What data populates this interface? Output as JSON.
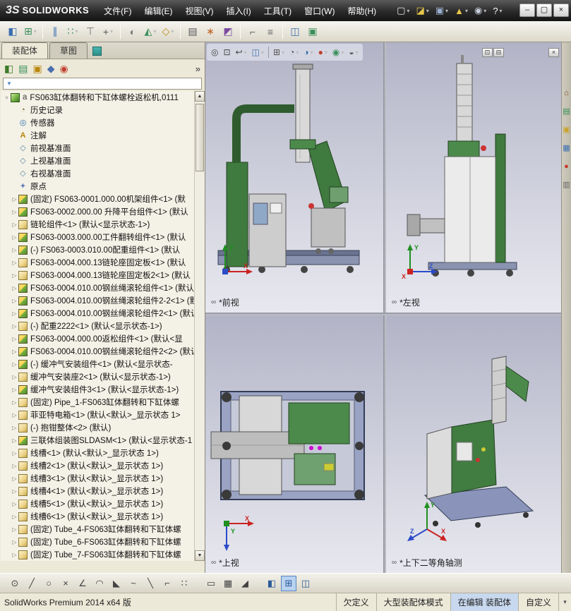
{
  "titlebar": {
    "logo_mark": "3S",
    "logo_text": "SOLIDWORKS",
    "menus": [
      {
        "key": "file",
        "label": "文件(F)"
      },
      {
        "key": "edit",
        "label": "编辑(E)"
      },
      {
        "key": "view",
        "label": "视图(V)"
      },
      {
        "key": "insert",
        "label": "插入(I)"
      },
      {
        "key": "tools",
        "label": "工具(T)"
      },
      {
        "key": "window",
        "label": "窗口(W)"
      },
      {
        "key": "help",
        "label": "帮助(H)"
      }
    ],
    "quick_icons": [
      {
        "name": "new-document-icon",
        "glyph": "▢",
        "color": "#e8e8e8",
        "dd": true
      },
      {
        "name": "open-document-icon",
        "glyph": "◪",
        "color": "#e8c84a",
        "dd": true
      },
      {
        "name": "save-icon",
        "glyph": "▣",
        "color": "#9ab0d0",
        "dd": true
      },
      {
        "name": "rebuild-alert-icon",
        "glyph": "▲",
        "color": "#e8c84a",
        "dd": true
      },
      {
        "name": "options-gear-icon",
        "glyph": "◉",
        "color": "#c8d0dc",
        "dd": true
      },
      {
        "name": "help-icon",
        "glyph": "?",
        "color": "#ffffff",
        "dd": true
      }
    ],
    "window_buttons": [
      {
        "name": "minimize-button",
        "glyph": "–"
      },
      {
        "name": "maximize-button",
        "glyph": "▢"
      },
      {
        "name": "close-button",
        "glyph": "×"
      }
    ]
  },
  "toolbar": {
    "items": [
      {
        "name": "edit-component-icon",
        "glyph": "◧",
        "color": "#3a6fb0"
      },
      {
        "name": "insert-component-icon",
        "glyph": "⊞",
        "color": "#3a8f5a",
        "dd": true
      },
      {
        "sep": true
      },
      {
        "name": "mate-icon",
        "glyph": "∥",
        "color": "#3a6fb0"
      },
      {
        "name": "component-pattern-icon",
        "glyph": "∷",
        "color": "#3a8f5a",
        "dd": true
      },
      {
        "name": "smart-fasteners-icon",
        "glyph": "⊤",
        "color": "#707070"
      },
      {
        "name": "move-component-icon",
        "glyph": "+",
        "color": "#555555",
        "dd": true
      },
      {
        "sep": true
      },
      {
        "name": "show-hidden-components-icon",
        "glyph": "◐",
        "color": "#777777"
      },
      {
        "name": "assembly-features-icon",
        "glyph": "◭",
        "color": "#3a8f5a",
        "dd": true
      },
      {
        "name": "reference-geometry-icon",
        "glyph": "◇",
        "color": "#b8860b",
        "dd": true
      },
      {
        "sep": true
      },
      {
        "name": "bill-of-materials-icon",
        "glyph": "▤",
        "color": "#555555"
      },
      {
        "name": "exploded-view-icon",
        "glyph": "∗",
        "color": "#c06020"
      },
      {
        "name": "interference-detection-icon",
        "glyph": "◩",
        "color": "#7a4aa0"
      },
      {
        "sep": true
      },
      {
        "name": "measure-icon",
        "glyph": "⌐",
        "color": "#666666"
      },
      {
        "name": "mass-properties-icon",
        "glyph": "≡",
        "color": "#666666"
      },
      {
        "sep": true
      },
      {
        "name": "section-view-icon",
        "glyph": "◫",
        "color": "#3a6fb0"
      },
      {
        "name": "screen-capture-icon",
        "glyph": "▣",
        "color": "#3a8f5a"
      }
    ]
  },
  "left_panel": {
    "tabs": [
      {
        "key": "assembly",
        "label": "装配体",
        "active": true
      },
      {
        "key": "sketch",
        "label": "草图",
        "active": false
      }
    ],
    "header_icons": [
      {
        "name": "featuremanager-tree-icon",
        "glyph": "◧",
        "color": "#3d7a28"
      },
      {
        "name": "propertymanager-icon",
        "glyph": "▤",
        "color": "#2e8b57"
      },
      {
        "name": "configurationmanager-icon",
        "glyph": "▣",
        "color": "#b8860b"
      },
      {
        "name": "dimxpertmanager-icon",
        "glyph": "◆",
        "color": "#4a6fae"
      },
      {
        "name": "displaymanager-icon",
        "glyph": "◉",
        "color": "#c04030"
      }
    ],
    "chevron": "»"
  },
  "tree": {
    "root": {
      "icon": "root_asm",
      "prefix": "a",
      "exp": true,
      "label": "FS063缸体翻转和下缸体螺栓返松机,0111"
    },
    "items": [
      {
        "icon": "history",
        "label": "历史记录"
      },
      {
        "icon": "sensor",
        "label": "传感器"
      },
      {
        "icon": "annotation",
        "label": "注解"
      },
      {
        "icon": "plane",
        "label": "前视基准面"
      },
      {
        "icon": "plane",
        "label": "上视基准面"
      },
      {
        "icon": "plane",
        "label": "右视基准面"
      },
      {
        "icon": "origin",
        "label": "原点"
      },
      {
        "icon": "asm",
        "exp": true,
        "label": "(固定) FS063-0001.000.00机架组件<1> (默"
      },
      {
        "icon": "asm",
        "exp": true,
        "label": "FS063-0002.000.00 升降平台组件<1> (默认"
      },
      {
        "icon": "part",
        "exp": true,
        "label": "链轮组件<1> (默认<显示状态-1>)"
      },
      {
        "icon": "asm",
        "exp": true,
        "label": "FS063-0003.000.00工件翻转组件<1> (默认"
      },
      {
        "icon": "asm",
        "exp": true,
        "label": "(-) FS063-0003.010.00配重组件<1> (默认"
      },
      {
        "icon": "part",
        "exp": true,
        "label": "FS063-0004.000.13链轮座固定板<1> (默认"
      },
      {
        "icon": "part",
        "exp": true,
        "label": "FS063-0004.000.13链轮座固定板2<1> (默认"
      },
      {
        "icon": "asm",
        "exp": true,
        "label": "FS063-0004.010.00钢丝绳滚轮组件<1> (默认"
      },
      {
        "icon": "asm",
        "exp": true,
        "label": "FS063-0004.010.00钢丝绳滚轮组件2-2<1> (默"
      },
      {
        "icon": "asm",
        "exp": true,
        "label": "FS063-0004.010.00钢丝绳滚轮组件2<1> (默认"
      },
      {
        "icon": "part",
        "exp": true,
        "label": "(-) 配重2222<1> (默认<显示状态-1>)"
      },
      {
        "icon": "asm",
        "exp": true,
        "label": "FS063-0004.000.00返松组件<1> (默认<显"
      },
      {
        "icon": "asm",
        "exp": true,
        "label": "FS063-0004.010.00钢丝绳滚轮组件2<2> (默认"
      },
      {
        "icon": "asm",
        "exp": true,
        "label": "(-) 缓冲气安装组件<1> (默认<显示状态-"
      },
      {
        "icon": "part",
        "exp": true,
        "label": "缓冲气安装座2<1> (默认<显示状态-1>)"
      },
      {
        "icon": "asm",
        "exp": true,
        "label": "缓冲气安装组件3<1> (默认<显示状态-1>)"
      },
      {
        "icon": "part",
        "exp": true,
        "label": "(固定) Pipe_1-FS063缸体翻转和下缸体螺"
      },
      {
        "icon": "part",
        "exp": true,
        "label": "菲亚特电箱<1> (默认<默认>_显示状态 1>"
      },
      {
        "icon": "part",
        "exp": true,
        "label": "(-) 抱钳整体<2> (默认)"
      },
      {
        "icon": "asm",
        "exp": true,
        "label": "三联体组装图SLDASM<1> (默认<显示状态-1"
      },
      {
        "icon": "part",
        "exp": true,
        "label": "线槽<1> (默认<默认>_显示状态 1>)"
      },
      {
        "icon": "part",
        "exp": true,
        "label": "线槽2<1> (默认<默认>_显示状态 1>)"
      },
      {
        "icon": "part",
        "exp": true,
        "label": "线槽3<1> (默认<默认>_显示状态 1>)"
      },
      {
        "icon": "part",
        "exp": true,
        "label": "线槽4<1> (默认<默认>_显示状态 1>)"
      },
      {
        "icon": "part",
        "exp": true,
        "label": "线槽5<1> (默认<默认>_显示状态 1>)"
      },
      {
        "icon": "part",
        "exp": true,
        "label": "线槽6<1> (默认<默认>_显示状态 1>)"
      },
      {
        "icon": "part",
        "exp": true,
        "label": "(固定) Tube_4-FS063缸体翻转和下缸体螺"
      },
      {
        "icon": "part",
        "exp": true,
        "label": "(固定) Tube_6-FS063缸体翻转和下缸体螺"
      },
      {
        "icon": "part",
        "exp": true,
        "label": "(固定) Tube_7-FS063缸体翻转和下缸体螺"
      }
    ]
  },
  "hud": {
    "items": [
      {
        "name": "zoom-to-fit-icon",
        "glyph": "◎",
        "color": "#444444"
      },
      {
        "name": "zoom-to-area-icon",
        "glyph": "⊡",
        "color": "#444444"
      },
      {
        "name": "previous-view-icon",
        "glyph": "↩",
        "color": "#444444",
        "dd": true
      },
      {
        "name": "section-view-icon",
        "glyph": "◫",
        "color": "#3a6fb0",
        "dd": true
      },
      {
        "sep": true
      },
      {
        "name": "view-orientation-icon",
        "glyph": "⊞",
        "color": "#555555",
        "dd": true
      },
      {
        "name": "display-style-icon",
        "glyph": "◔",
        "color": "#555555",
        "dd": true
      },
      {
        "name": "hide-show-items-icon",
        "glyph": "◑",
        "color": "#3a6fb0",
        "dd": true
      },
      {
        "name": "edit-appearance-icon",
        "glyph": "●",
        "color": "#c04030",
        "dd": true
      },
      {
        "name": "apply-scene-icon",
        "glyph": "◉",
        "color": "#3a8f5a",
        "dd": true
      },
      {
        "name": "view-settings-icon",
        "glyph": "◒",
        "color": "#555555",
        "dd": true
      }
    ]
  },
  "viewports": {
    "front": {
      "label": "*前视"
    },
    "left": {
      "label": "*左视"
    },
    "top": {
      "label": "*上视"
    },
    "iso": {
      "label": "*上下二等角轴测"
    },
    "triad_axes": {
      "x": "X",
      "y": "Y",
      "z": "Z"
    }
  },
  "window_child_buttons": [
    {
      "name": "viewport-restore-button",
      "glyph": "⊡"
    },
    {
      "name": "viewport-minimize-button",
      "glyph": "⊟"
    }
  ],
  "viewport_close_glyph": "×",
  "task_pane": {
    "icons": [
      {
        "name": "solidworks-resources-icon",
        "glyph": "⌂",
        "color": "#7a4a2a"
      },
      {
        "name": "design-library-icon",
        "glyph": "▤",
        "color": "#2f8f4f"
      },
      {
        "name": "file-explorer-icon",
        "glyph": "▣",
        "color": "#c9a227"
      },
      {
        "name": "view-palette-icon",
        "glyph": "▦",
        "color": "#3a6fb0"
      },
      {
        "name": "appearances-scenes-icon",
        "glyph": "●",
        "color": "#c23a2a"
      },
      {
        "name": "custom-properties-icon",
        "glyph": "▥",
        "color": "#666666"
      }
    ]
  },
  "bottom_toolbar": {
    "items": [
      {
        "name": "sketch-point-icon",
        "glyph": "⊙",
        "color": "#444444"
      },
      {
        "name": "sketch-line-icon",
        "glyph": "╱",
        "color": "#444444"
      },
      {
        "name": "sketch-circle-icon",
        "glyph": "○",
        "color": "#444444"
      },
      {
        "name": "sketch-trim-icon",
        "glyph": "×",
        "color": "#444444"
      },
      {
        "name": "sketch-angle-icon",
        "glyph": "∠",
        "color": "#444444"
      },
      {
        "name": "sketch-arc-icon",
        "glyph": "◠",
        "color": "#444444"
      },
      {
        "name": "sketch-fillet-icon",
        "glyph": "◣",
        "color": "#444444"
      },
      {
        "name": "sketch-spline-icon",
        "glyph": "~",
        "color": "#444444"
      },
      {
        "name": "sketch-mirror-icon",
        "glyph": "╲",
        "color": "#444444"
      },
      {
        "name": "sketch-dimension-icon",
        "glyph": "⌐",
        "color": "#444444"
      },
      {
        "name": "sketch-pattern-icon",
        "glyph": "∷",
        "color": "#444444"
      },
      {
        "sep": true
      },
      {
        "name": "slot-icon",
        "glyph": "▭",
        "color": "#444444"
      },
      {
        "name": "grid-system-icon",
        "glyph": "▦",
        "color": "#444444"
      },
      {
        "name": "instant3d-icon",
        "glyph": "◢",
        "color": "#444444"
      },
      {
        "sep": true
      },
      {
        "name": "single-view-button",
        "glyph": "◧",
        "color": "#2a5a9a"
      },
      {
        "name": "four-view-button",
        "glyph": "⊞",
        "color": "#2a5a9a",
        "active": true
      },
      {
        "name": "link-views-button",
        "glyph": "◫",
        "color": "#2a5a9a"
      }
    ]
  },
  "statusbar": {
    "app_version": "SolidWorks Premium 2014 x64 版",
    "define_state": "欠定义",
    "mode": "大型装配体模式",
    "editing": "在编辑 装配体",
    "custom": "自定义"
  }
}
